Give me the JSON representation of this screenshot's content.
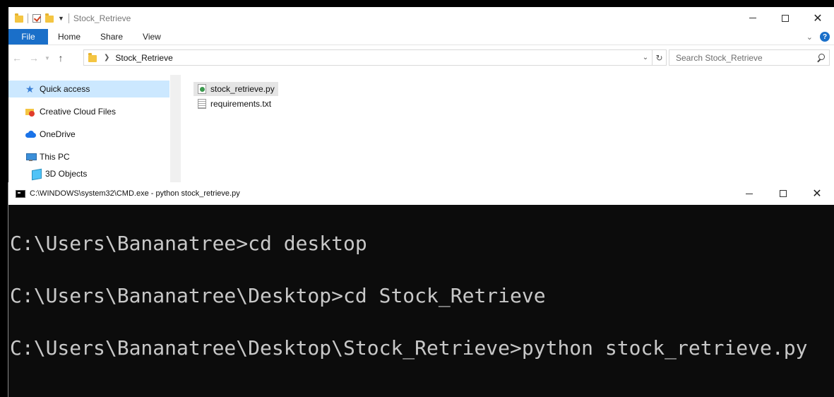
{
  "explorer": {
    "title": "Stock_Retrieve",
    "ribbon_tabs": [
      "File",
      "Home",
      "Share",
      "View"
    ],
    "address_path": "Stock_Retrieve",
    "search_placeholder": "Search Stock_Retrieve",
    "nav_items": [
      {
        "label": "Quick access",
        "icon": "star-icon"
      },
      {
        "label": "Creative Cloud Files",
        "icon": "creative-cloud-icon"
      },
      {
        "label": "OneDrive",
        "icon": "onedrive-icon"
      },
      {
        "label": "This PC",
        "icon": "computer-icon"
      },
      {
        "label": "3D Objects",
        "icon": "cube-icon"
      }
    ],
    "files": [
      {
        "name": "stock_retrieve.py",
        "icon": "python-file-icon",
        "selected": true
      },
      {
        "name": "requirements.txt",
        "icon": "text-file-icon",
        "selected": false
      }
    ]
  },
  "cmd": {
    "title": "C:\\WINDOWS\\system32\\CMD.exe - python  stock_retrieve.py",
    "lines": [
      "C:\\Users\\Bananatree>cd desktop",
      "C:\\Users\\Bananatree\\Desktop>cd Stock_Retrieve",
      "C:\\Users\\Bananatree\\Desktop\\Stock_Retrieve>python stock_retrieve.py"
    ]
  },
  "colors": {
    "accent": "#1a6fc9",
    "selection": "#cce8ff",
    "console_bg": "#0c0c0c",
    "console_text": "#c8c8c8"
  }
}
